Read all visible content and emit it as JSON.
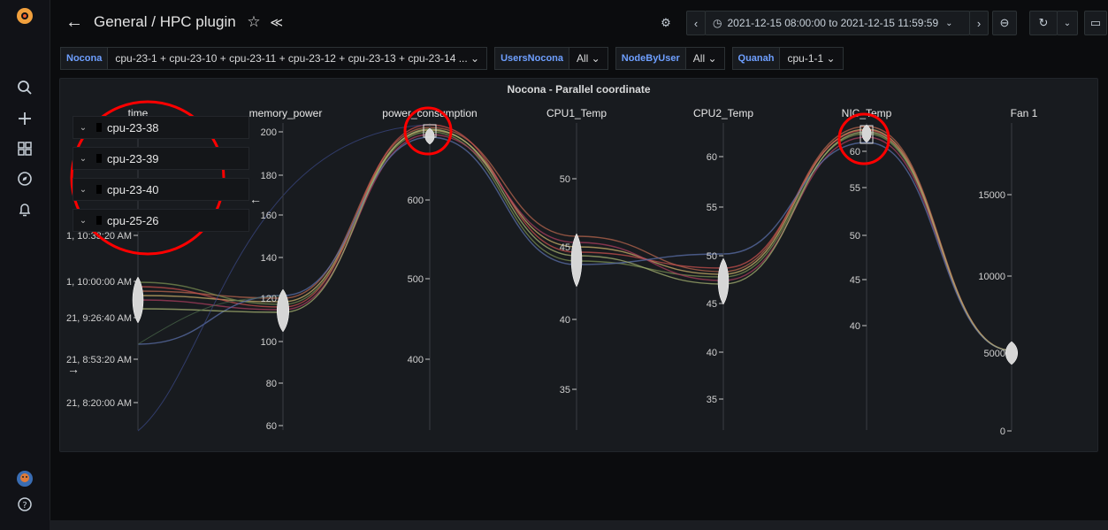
{
  "breadcrumb": {
    "folder": "General",
    "separator": "/",
    "dashboard": "HPC plugin"
  },
  "time_range": "2021-12-15 08:00:00 to 2021-12-15 11:59:59",
  "variables": [
    {
      "label": "Nocona",
      "value": "cpu-23-1 + cpu-23-10 + cpu-23-11 + cpu-23-12 + cpu-23-13 + cpu-23-14 ...  ⌄"
    },
    {
      "label": "UsersNocona",
      "value": "All ⌄"
    },
    {
      "label": "NodeByUser",
      "value": "All ⌄"
    },
    {
      "label": "Quanah",
      "value": "cpu-1-1 ⌄"
    }
  ],
  "panel": {
    "title": "Nocona - Parallel coordinate"
  },
  "legend_items": [
    "cpu-23-38",
    "cpu-23-39",
    "cpu-23-40",
    "cpu-25-26"
  ],
  "icons": {
    "logo": "grafana-logo",
    "search": "search-icon",
    "add": "plus-icon",
    "dashboards": "dashboards-icon",
    "explore": "compass-icon",
    "alerts": "bell-icon",
    "user": "avatar",
    "help": "help-icon"
  },
  "chart_data": {
    "type": "parallel-coordinates",
    "axes": [
      {
        "name": "time",
        "ticks": [
          "1, 10:33:20 AM",
          "1, 10:00:00 AM",
          "21, 9:26:40 AM",
          "21, 8:53:20 AM",
          "21, 8:20:00 AM"
        ]
      },
      {
        "name": "memory_power",
        "ticks": [
          "200",
          "180",
          "160",
          "140",
          "120",
          "100",
          "80",
          "60"
        ]
      },
      {
        "name": "power_consumption",
        "ticks": [
          "600",
          "500",
          "400"
        ]
      },
      {
        "name": "CPU1_Temp",
        "ticks": [
          "50",
          "45",
          "40",
          "35"
        ]
      },
      {
        "name": "CPU2_Temp",
        "ticks": [
          "60",
          "55",
          "50",
          "45",
          "40",
          "35"
        ]
      },
      {
        "name": "NIC_Temp",
        "ticks": [
          "60",
          "55",
          "50",
          "45",
          "40"
        ]
      },
      {
        "name": "Fan 1",
        "ticks": [
          "15000",
          "10000",
          "5000",
          "0"
        ]
      }
    ],
    "line_colors": [
      "#b5654e",
      "#c9b06a",
      "#7a8f52",
      "#c4504e",
      "#a83d5d",
      "#5a6fa8",
      "#a6b372"
    ]
  },
  "annotations": {
    "circle_color": "#ff0000"
  }
}
